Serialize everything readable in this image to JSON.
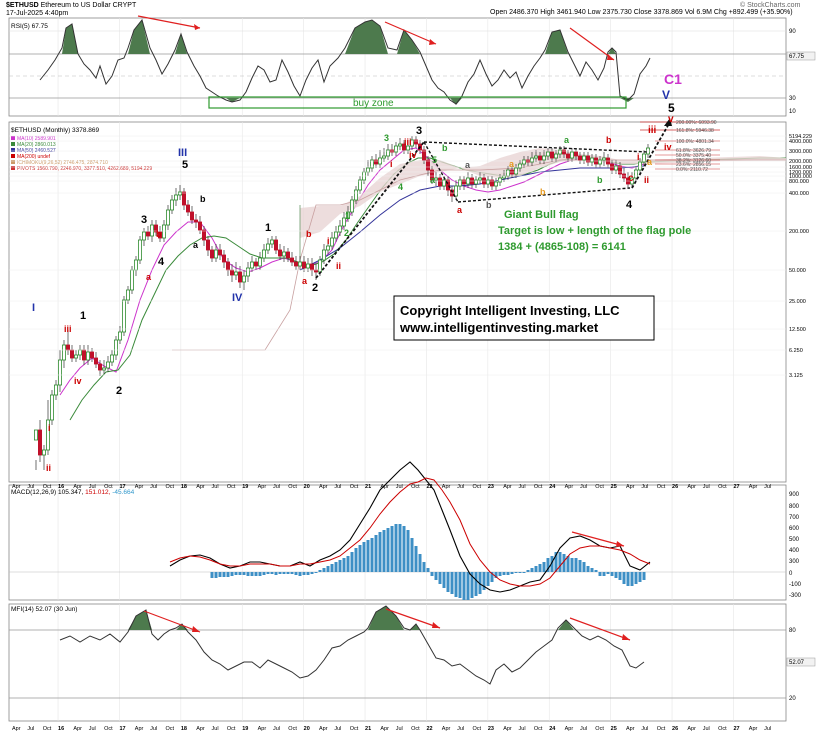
{
  "header": {
    "symbol": "$ETHUSD",
    "name": "Ethereum to US Dollar",
    "exchange": "CRYPT",
    "date": "17-Jul-2025 4:40pm",
    "open_label": "Open",
    "open": "2486.370",
    "high_label": "High",
    "high": "3461.940",
    "low_label": "Low",
    "low": "2375.730",
    "close_label": "Close",
    "close": "3378.869",
    "volume_label": "Vol",
    "volume": "6.9M",
    "change_label": "Chg",
    "change": "+892.499 (+35.90%)",
    "brand": "© StockCharts.com"
  },
  "rsi": {
    "label": "RSI(5) 67.75",
    "levels": [
      "90",
      "70",
      "30",
      "10"
    ],
    "last": "67.75",
    "buy_zone": "buy zone"
  },
  "main": {
    "title_line": "$ETHUSD (Monthly) 3378.869",
    "legend": [
      {
        "text": "MA(10) 2589.901",
        "color": "#cc33cc"
      },
      {
        "text": "MA(20) 2860.013",
        "color": "#3a8a3a"
      },
      {
        "text": "MA(50) 2460.527",
        "color": "#333399"
      },
      {
        "text": "MA(200) undef",
        "color": "#cc0000"
      },
      {
        "text": "ICHIMOKU(9,26,52) 2746.475, 2874.710",
        "color": "#cc9966"
      },
      {
        "text": "PIVOTS 1560.790, 2246.970, 3377.510, 4262.689, 5194.229",
        "color": "#cc3333"
      }
    ],
    "price_axis": [
      "5194.229",
      "4000.000",
      "3000.000",
      "2000.000",
      "1600.000",
      "1200.000",
      "1000.000",
      "800.000",
      "400.000",
      "200.000",
      "50.000",
      "25.000",
      "12.500",
      "6.250",
      "3.125"
    ],
    "fib_labels": [
      "200.00%: 6093.90",
      "161.8%: 5946.38",
      "100.0%: 4801.34",
      "61.8%: 3626.79",
      "50.0%: 3375.40",
      "38.2%: 3126.60",
      "23.6%: 2856.15",
      "0.0%: 2110.72"
    ],
    "flag_text": [
      "Giant Bull flag",
      "Target is low + length of the flag pole",
      "1384 + (4865-108) = 6141"
    ],
    "copyright": [
      "Copyright Intelligent Investing, LLC",
      "www.intelligentinvesting.market"
    ],
    "wave_labels": {
      "c1": "C1",
      "v_blue": "V",
      "v_red": "v",
      "iii_roman": "iii",
      "iv_roman": "iv",
      "i_red": "i",
      "ii_red": "ii",
      "c_red": "c",
      "one": "1",
      "two": "2",
      "three": "3",
      "four": "4",
      "five": "5",
      "a": "a",
      "b": "b",
      "I": "I",
      "III": "III",
      "IV": "IV"
    }
  },
  "macd": {
    "label": "MACD(12,26,9) 105.347, 151.012, -45.664",
    "label_parts": [
      "MACD(12,26,9)",
      "105.347,",
      "151.012,",
      "-45.664"
    ],
    "axis": [
      "900",
      "800",
      "700",
      "600",
      "500",
      "400",
      "300",
      "200",
      "100",
      "0",
      "-100",
      "-200",
      "-300"
    ]
  },
  "mfi": {
    "label": "MFI(14) 52.07 (30 Jun)",
    "axis": [
      "80",
      "20"
    ],
    "last": "52.07"
  },
  "x_axis": [
    "Apr",
    "Jul",
    "Oct",
    "16",
    "Apr",
    "Jul",
    "Oct",
    "17",
    "Apr",
    "Jul",
    "Oct",
    "18",
    "Apr",
    "Jul",
    "Oct",
    "19",
    "Apr",
    "Jul",
    "Oct",
    "20",
    "Apr",
    "Jul",
    "Oct",
    "21",
    "Apr",
    "Jul",
    "Oct",
    "22",
    "Apr",
    "Jul",
    "Oct",
    "23",
    "Apr",
    "Jul",
    "Oct",
    "24",
    "Apr",
    "Jul",
    "Oct",
    "25",
    "Apr",
    "Jul",
    "Oct",
    "26",
    "Apr",
    "Jul",
    "Oct",
    "27",
    "Apr",
    "Jul"
  ],
  "chart_data": [
    {
      "type": "line",
      "title": "RSI(5) 67.75",
      "ylim": [
        0,
        100
      ],
      "levels": [
        90,
        70,
        50,
        30,
        10
      ]
    },
    {
      "type": "candlestick",
      "title": "$ETHUSD (Monthly) 3378.869",
      "scale": "log",
      "ylim": [
        1.5,
        6500
      ],
      "values": {
        "open": 2486.37,
        "high": 3461.94,
        "low": 2375.73,
        "close": 3378.869
      },
      "target": 6141,
      "fib_retracements": [
        {
          "label": "200.00%",
          "value": 6093.9
        },
        {
          "label": "161.8%",
          "value": 5946.38
        },
        {
          "label": "100.0%",
          "value": 4801.34
        },
        {
          "label": "61.8%",
          "value": 3626.79
        },
        {
          "label": "50.0%",
          "value": 3375.4
        },
        {
          "label": "38.2%",
          "value": 3126.6
        },
        {
          "label": "23.6%",
          "value": 2856.15
        },
        {
          "label": "0.0%",
          "value": 2110.72
        }
      ]
    },
    {
      "type": "line",
      "title": "MACD(12,26,9)",
      "series": [
        {
          "name": "MACD",
          "last": 105.347
        },
        {
          "name": "Signal",
          "last": 151.012
        },
        {
          "name": "Histogram",
          "last": -45.664
        }
      ],
      "ylim": [
        -300,
        950
      ]
    },
    {
      "type": "line",
      "title": "MFI(14)",
      "last": 52.07,
      "ylim": [
        0,
        100
      ],
      "levels": [
        80,
        20
      ]
    }
  ]
}
